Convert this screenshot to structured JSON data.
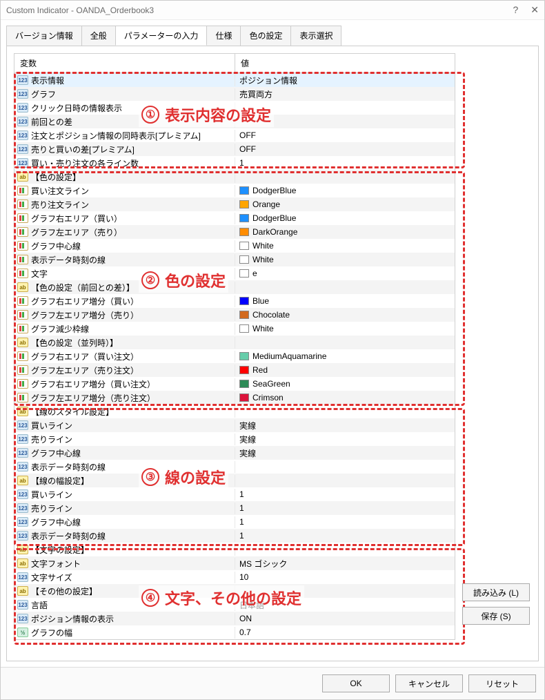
{
  "window": {
    "title": "Custom Indicator - OANDA_Orderbook3",
    "help": "?",
    "close": "✕"
  },
  "tabs": [
    "バージョン情報",
    "全般",
    "パラメーターの入力",
    "仕様",
    "色の設定",
    "表示選択"
  ],
  "activeTabIndex": 2,
  "grid": {
    "headers": {
      "name": "変数",
      "value": "値"
    },
    "rows": [
      {
        "icon": "int",
        "name": "表示情報",
        "value": "ポジション情報",
        "selected": true
      },
      {
        "icon": "int",
        "name": "グラフ",
        "value": "売買両方"
      },
      {
        "icon": "int",
        "name": "クリック日時の情報表示",
        "value": ""
      },
      {
        "icon": "int",
        "name": "前回との差",
        "value": ""
      },
      {
        "icon": "int",
        "name": "注文とポジション情報の同時表示[プレミアム]",
        "value": "OFF"
      },
      {
        "icon": "int",
        "name": "売りと買いの差[プレミアム]",
        "value": "OFF"
      },
      {
        "icon": "int",
        "name": "買い・売り注文の各ライン数",
        "value": "1"
      },
      {
        "icon": "str",
        "name": "【色の設定】",
        "value": ""
      },
      {
        "icon": "color",
        "name": "買い注文ライン",
        "value": "DodgerBlue",
        "swatch": "#1e90ff"
      },
      {
        "icon": "color",
        "name": "売り注文ライン",
        "value": "Orange",
        "swatch": "#ffa500"
      },
      {
        "icon": "color",
        "name": "グラフ右エリア（買い）",
        "value": "DodgerBlue",
        "swatch": "#1e90ff"
      },
      {
        "icon": "color",
        "name": "グラフ左エリア（売り）",
        "value": "DarkOrange",
        "swatch": "#ff8c00"
      },
      {
        "icon": "color",
        "name": "グラフ中心線",
        "value": "White",
        "swatch": "#ffffff",
        "outline": true
      },
      {
        "icon": "color",
        "name": "表示データ時刻の線",
        "value": "White",
        "swatch": "#ffffff",
        "outline": true
      },
      {
        "icon": "color",
        "name": "文字",
        "value": "e",
        "swatch": "#ffffff",
        "outline": true
      },
      {
        "icon": "str",
        "name": "【色の設定（前回との差）】",
        "value": ""
      },
      {
        "icon": "color",
        "name": "グラフ右エリア増分（買い）",
        "value": "Blue",
        "swatch": "#0000ff"
      },
      {
        "icon": "color",
        "name": "グラフ左エリア増分（売り）",
        "value": "Chocolate",
        "swatch": "#d2691e"
      },
      {
        "icon": "color",
        "name": "グラフ減少枠線",
        "value": "White",
        "swatch": "#ffffff",
        "outline": true
      },
      {
        "icon": "str",
        "name": "【色の設定（並列時）】",
        "value": ""
      },
      {
        "icon": "color",
        "name": "グラフ右エリア（買い注文）",
        "value": "MediumAquamarine",
        "swatch": "#66cdaa"
      },
      {
        "icon": "color",
        "name": "グラフ左エリア（売り注文）",
        "value": "Red",
        "swatch": "#ff0000"
      },
      {
        "icon": "color",
        "name": "グラフ右エリア増分（買い注文）",
        "value": "SeaGreen",
        "swatch": "#2e8b57"
      },
      {
        "icon": "color",
        "name": "グラフ左エリア増分（売り注文）",
        "value": "Crimson",
        "swatch": "#dc143c"
      },
      {
        "icon": "str",
        "name": "【線のスタイル設定】",
        "value": ""
      },
      {
        "icon": "int",
        "name": "買いライン",
        "value": "実線"
      },
      {
        "icon": "int",
        "name": "売りライン",
        "value": "実線"
      },
      {
        "icon": "int",
        "name": "グラフ中心線",
        "value": "実線"
      },
      {
        "icon": "int",
        "name": "表示データ時刻の線",
        "value": ""
      },
      {
        "icon": "str",
        "name": "【線の幅設定】",
        "value": ""
      },
      {
        "icon": "int",
        "name": "買いライン",
        "value": "1"
      },
      {
        "icon": "int",
        "name": "売りライン",
        "value": "1"
      },
      {
        "icon": "int",
        "name": "グラフ中心線",
        "value": "1"
      },
      {
        "icon": "int",
        "name": "表示データ時刻の線",
        "value": "1"
      },
      {
        "icon": "str",
        "name": "【文字の設定】",
        "value": ""
      },
      {
        "icon": "str",
        "name": "文字フォント",
        "value": "MS ゴシック"
      },
      {
        "icon": "int",
        "name": "文字サイズ",
        "value": "10"
      },
      {
        "icon": "str",
        "name": "【その他の設定】",
        "value": ""
      },
      {
        "icon": "int",
        "name": "言語",
        "value": "日本語"
      },
      {
        "icon": "int",
        "name": "ポジション情報の表示",
        "value": "ON"
      },
      {
        "icon": "dbl",
        "name": "グラフの幅",
        "value": "0.7"
      }
    ]
  },
  "annotations": [
    {
      "num": "①",
      "label": "表示内容の設定"
    },
    {
      "num": "②",
      "label": "色の設定"
    },
    {
      "num": "③",
      "label": "線の設定"
    },
    {
      "num": "④",
      "label": "文字、その他の設定"
    }
  ],
  "buttons": {
    "load": "読み込み (L)",
    "save": "保存 (S)",
    "ok": "OK",
    "cancel": "キャンセル",
    "reset": "リセット"
  }
}
